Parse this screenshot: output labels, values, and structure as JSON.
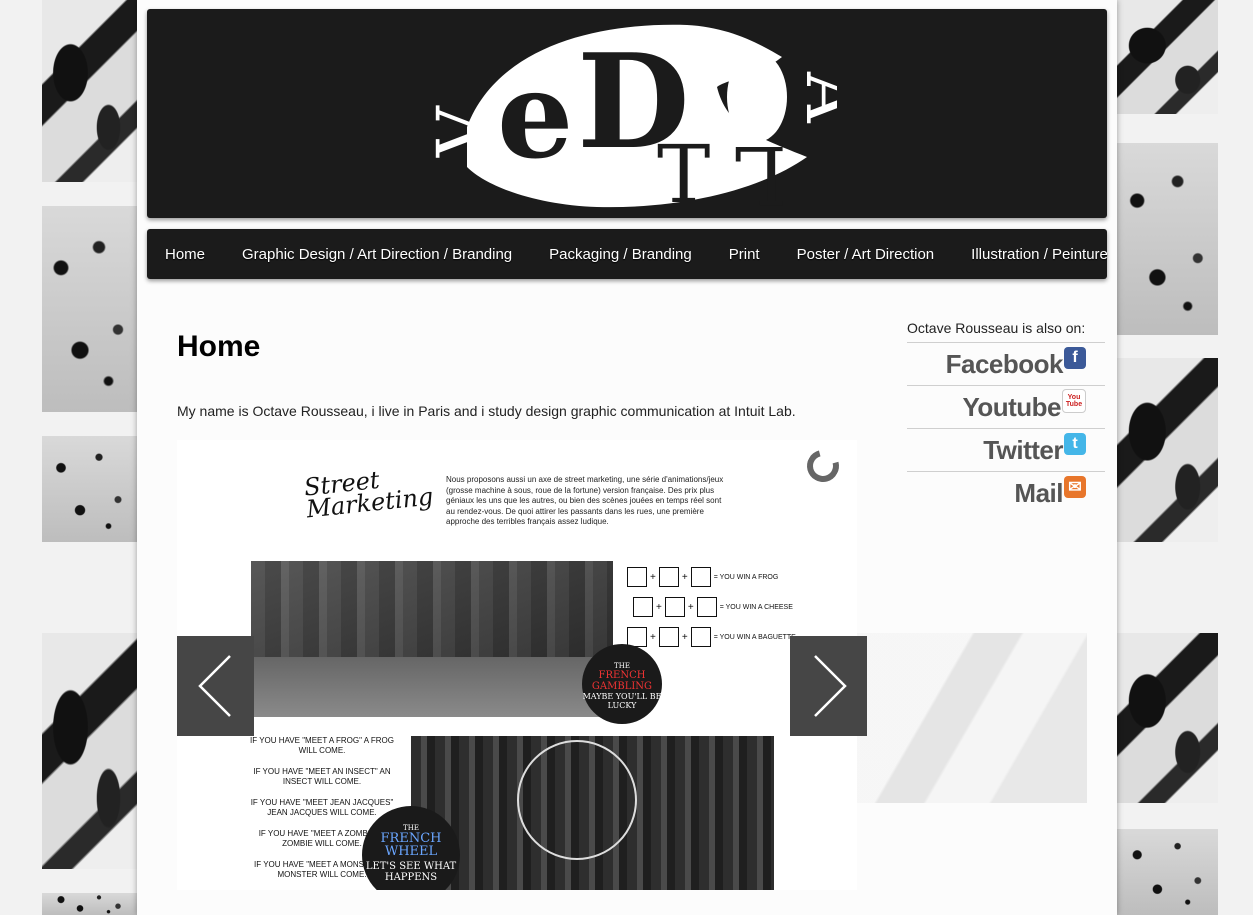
{
  "nav": {
    "items": [
      {
        "label": "Home"
      },
      {
        "label": "Graphic Design / Art Direction / Branding"
      },
      {
        "label": "Packaging / Branding"
      },
      {
        "label": "Print"
      },
      {
        "label": "Poster / Art Direction"
      },
      {
        "label": "Illustration / Peinture"
      }
    ]
  },
  "main": {
    "title": "Home",
    "intro": "My name is Octave Rousseau, i live in Paris and i study design graphic communication at Intuit Lab."
  },
  "sidebar": {
    "heading": "Octave Rousseau is also on:",
    "links": [
      {
        "label": "Facebook",
        "icon": "facebook-icon",
        "icon_glyph": "f",
        "color": "#3b5998"
      },
      {
        "label": "Youtube",
        "icon": "youtube-icon",
        "icon_glyph": "You Tube",
        "color": "#cc2020"
      },
      {
        "label": "Twitter",
        "icon": "twitter-icon",
        "icon_glyph": "t",
        "color": "#44b6e8"
      },
      {
        "label": "Mail",
        "icon": "mail-icon",
        "icon_glyph": "✉",
        "color": "#e8762b"
      }
    ]
  },
  "slide": {
    "heading_line1": "Street",
    "heading_line2": "Marketing",
    "description": "Nous proposons aussi un axe de street marketing, une série d'animations/jeux (grosse machine à sous, roue de la fortune) version française. Des prix plus géniaux les uns que les autres, ou bien des scènes jouées en temps réel sont au rendez-vous. De quoi attirer les passants dans les rues, une première approche des terribles français assez ludique.",
    "combos": [
      "= YOU WIN A FROG",
      "= YOU WIN A CHEESE",
      "= YOU WIN A BAGUETTE"
    ],
    "badge1": {
      "top": "THE",
      "title": "FRENCH GAMBLING",
      "sub": "MAYBE YOU'LL BE LUCKY"
    },
    "badge2": {
      "top": "THE",
      "title": "FRENCH WHEEL",
      "sub": "LET'S SEE WHAT HAPPENS"
    },
    "wheel_rules": [
      "IF YOU HAVE \"MEET A FROG\" A FROG WILL COME.",
      "IF YOU HAVE \"MEET AN INSECT\" AN INSECT WILL COME.",
      "IF YOU HAVE \"MEET JEAN JACQUES\" JEAN JACQUES WILL COME.",
      "IF YOU HAVE \"MEET A ZOMBIE\" A ZOMBIE WILL COME.",
      "IF YOU HAVE \"MEET A MONSTER\" A MONSTER WILL COME."
    ]
  }
}
